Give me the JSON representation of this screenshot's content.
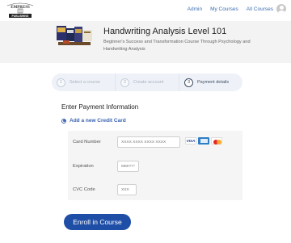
{
  "brand": {
    "logo_text_top": "EMPRESS",
    "logo_text_bottom": "PUBLISHING"
  },
  "nav": {
    "links": [
      "Admin",
      "My Courses",
      "All Courses"
    ]
  },
  "course": {
    "title": "Handwriting Analysis Level 101",
    "description": "Beginner's Success and Transformation Course Through Psychology and Handwriting Analysis"
  },
  "steps": [
    {
      "num": "1",
      "label": "Select a course",
      "state": "done"
    },
    {
      "num": "2",
      "label": "Create account",
      "state": "done"
    },
    {
      "num": "3",
      "label": "Payment details",
      "state": "active"
    }
  ],
  "payment": {
    "title": "Enter Payment Information",
    "option_label": "Add a new Credit Card",
    "card_number": {
      "label": "Card Number",
      "placeholder": "XXXX XXXX XXXX XXXX"
    },
    "expiration": {
      "label": "Expiration",
      "placeholder": "MM/YYYY"
    },
    "cvc": {
      "label": "CVC Code",
      "placeholder": "XXX"
    },
    "card_brands": [
      "visa",
      "amex",
      "mastercard"
    ],
    "visa_text": "VISA"
  },
  "actions": {
    "enroll_label": "Enroll in Course"
  },
  "colors": {
    "accent": "#1e4ea6",
    "link": "#3d6fb4",
    "banner_bg": "#f3f3f3"
  }
}
